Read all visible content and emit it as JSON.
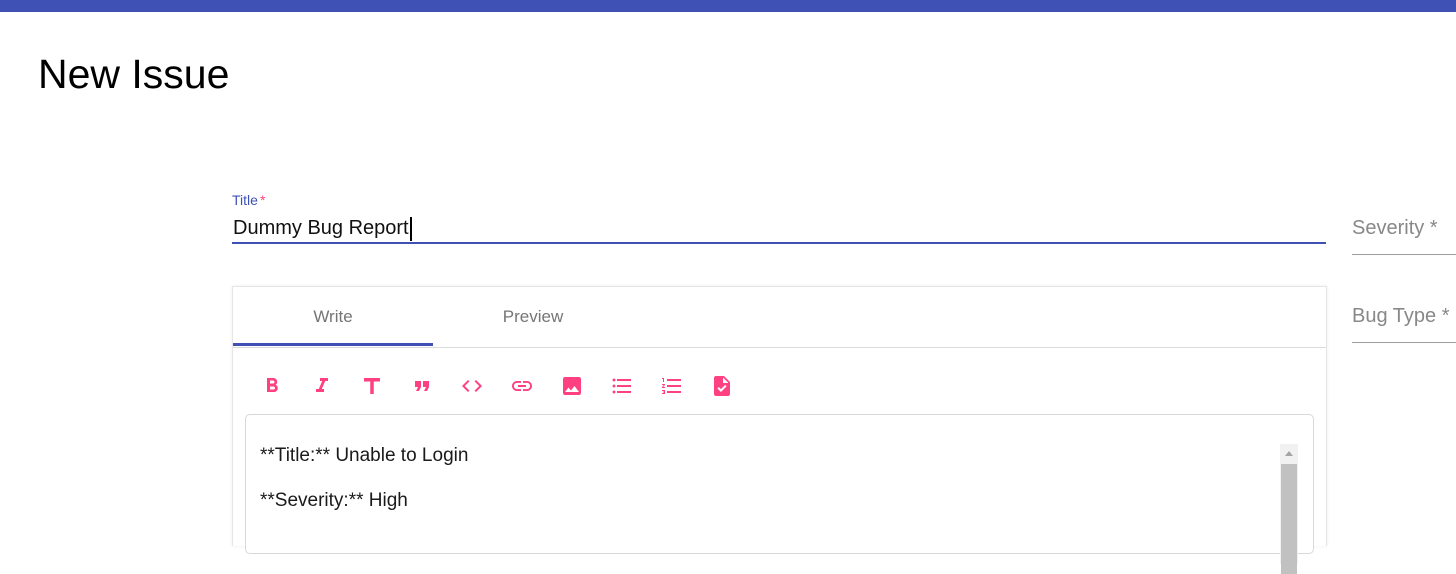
{
  "page": {
    "title": "New Issue"
  },
  "colors": {
    "primary": "#3f51b5",
    "accent": "#ff4081",
    "muted": "#757575"
  },
  "title_field": {
    "label": "Title",
    "required_mark": "*",
    "value": "Dummy Bug Report"
  },
  "severity_field": {
    "placeholder": "Severity *"
  },
  "bug_type_field": {
    "placeholder": "Bug Type *"
  },
  "editor": {
    "tabs": [
      {
        "label": "Write",
        "active": true
      },
      {
        "label": "Preview",
        "active": false
      }
    ],
    "toolbar": [
      {
        "icon": "bold-icon"
      },
      {
        "icon": "italic-icon"
      },
      {
        "icon": "heading-icon"
      },
      {
        "icon": "quote-icon"
      },
      {
        "icon": "code-icon"
      },
      {
        "icon": "link-icon"
      },
      {
        "icon": "image-icon"
      },
      {
        "icon": "unordered-list-icon"
      },
      {
        "icon": "ordered-list-icon"
      },
      {
        "icon": "checked-list-icon"
      }
    ],
    "content_lines": [
      "**Title:** Unable to Login",
      "**Severity:** High"
    ]
  }
}
